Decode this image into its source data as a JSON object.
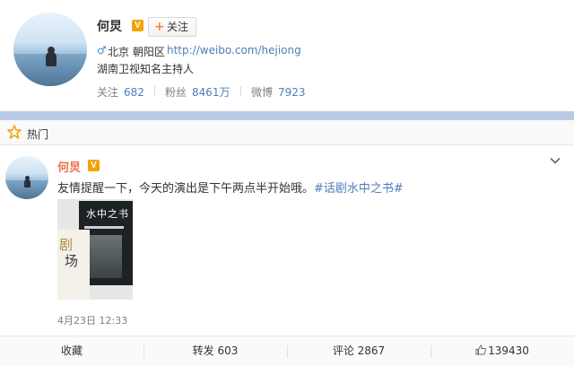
{
  "profile": {
    "name": "何炅",
    "verified_badge": "V",
    "follow_label": "关注",
    "gender_icon": "♂",
    "location": "北京 朝阳区",
    "homepage": "http://weibo.com/hejiong",
    "bio": "湖南卫视知名主持人",
    "stats": [
      {
        "label": "关注",
        "value": "682"
      },
      {
        "label": "粉丝",
        "value": "8461万"
      },
      {
        "label": "微博",
        "value": "7923"
      }
    ]
  },
  "hot": {
    "label": "热门",
    "icon": "star-icon"
  },
  "post": {
    "author": "何炅",
    "verified_badge": "V",
    "text": "友情提醒一下，今天的演出是下午两点半开始哦。",
    "tag": "#话剧水中之书#",
    "image": {
      "poster_title": "水中之书",
      "book_text_1": "剧",
      "book_text_2": "场"
    },
    "time": "4月23日 12:33"
  },
  "actions": {
    "favorite": "收藏",
    "repost": "转发 603",
    "comment": "评论 2867",
    "like": "139430"
  },
  "colors": {
    "link": "#4f7dba",
    "author": "#eb7350",
    "badge": "#f2a300",
    "accent_bar": "#b7cbe6"
  }
}
